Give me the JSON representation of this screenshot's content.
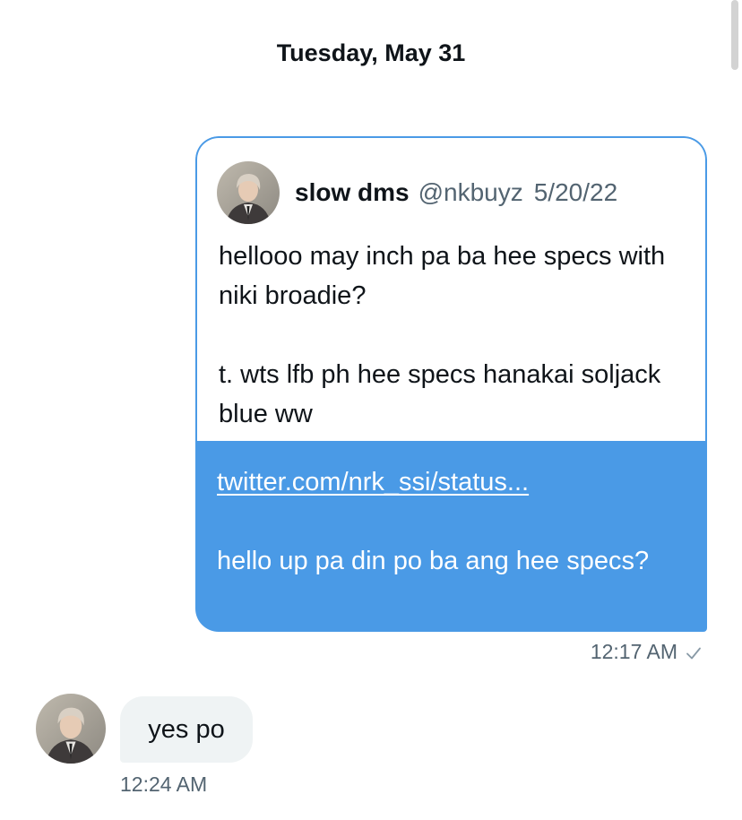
{
  "date_header": "Tuesday, May 31",
  "outgoing": {
    "quoted_tweet": {
      "display_name": "slow dms",
      "handle": "@nkbuyz",
      "date": "5/20/22",
      "text": "hellooo may inch pa ba hee specs with niki broadie?\n\nt. wts lfb ph hee specs hanakai soljack blue ww"
    },
    "link_text": "twitter.com/nrk_ssi/status...",
    "message": "hello up pa din po ba ang hee specs?",
    "time": "12:17 AM",
    "status_icon": "check-icon"
  },
  "incoming": {
    "message": "yes po",
    "time": "12:24 AM",
    "avatar_icon": "avatar"
  },
  "colors": {
    "accent_blue": "#4a9ae6",
    "incoming_bubble": "#eff3f4",
    "meta_gray": "#536471"
  }
}
